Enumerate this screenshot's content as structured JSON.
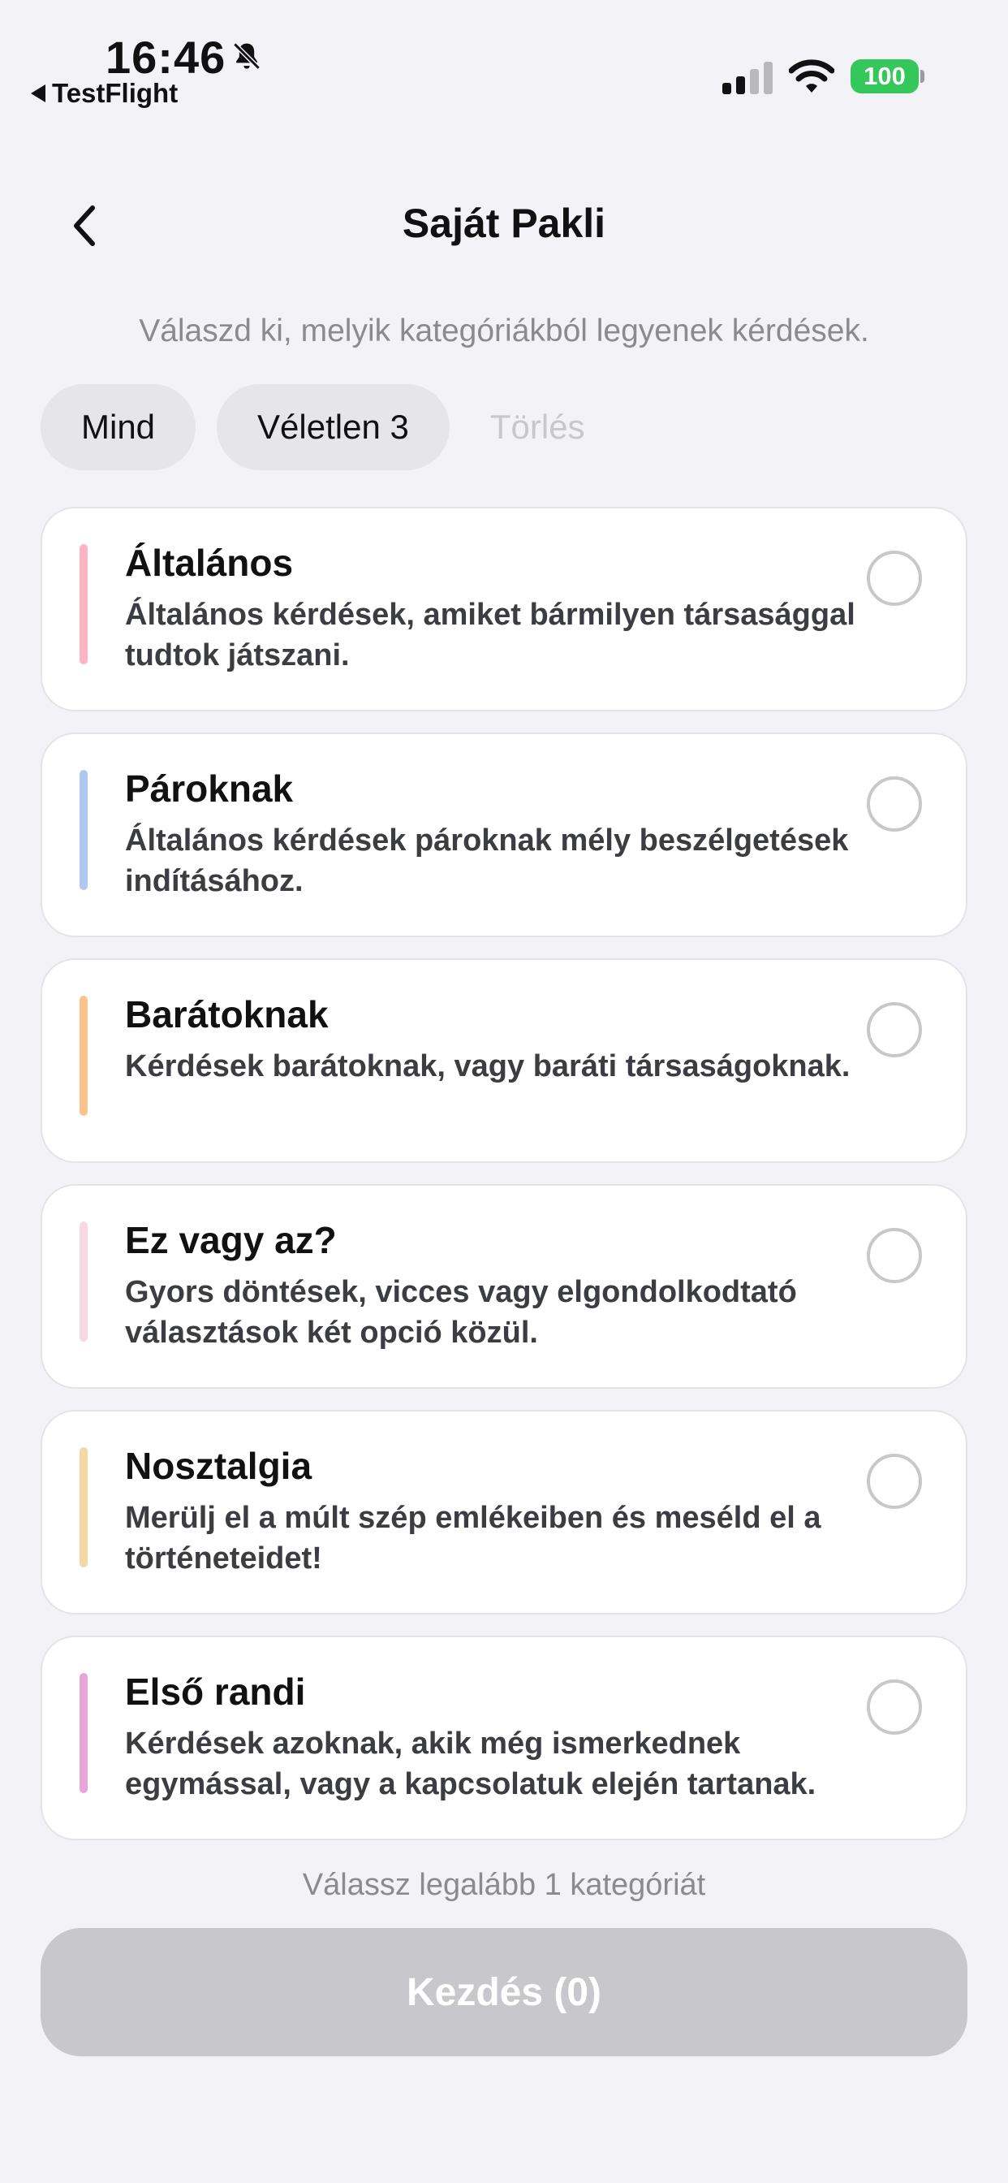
{
  "status_bar": {
    "time": "16:46",
    "back_app": "TestFlight",
    "battery": "100",
    "icons": [
      "bell-slash-icon",
      "cellular-signal-icon",
      "wifi-icon",
      "battery-icon"
    ]
  },
  "header": {
    "title": "Saját Pakli",
    "back_icon": "chevron-left-icon"
  },
  "subtitle": "Válaszd ki, melyik kategóriákból legyenek kérdések.",
  "chips": {
    "all": "Mind",
    "random": "Véletlen 3",
    "clear": "Törlés"
  },
  "categories": [
    {
      "title": "Általános",
      "description": "Általános kérdések, amiket bármilyen társasággal tudtok játszani.",
      "color": "#fbb5c4",
      "selected": false
    },
    {
      "title": "Pároknak",
      "description": "Általános kérdések pároknak mély beszélgetések indításához.",
      "color": "#aec8ef",
      "selected": false
    },
    {
      "title": "Barátoknak",
      "description": "Kérdések barátoknak, vagy baráti társaságoknak.",
      "color": "#f9c48f",
      "selected": false
    },
    {
      "title": "Ez vagy az?",
      "description": "Gyors döntések, vicces vagy elgondolkodtató választások két opció közül.",
      "color": "#f8d8e2",
      "selected": false
    },
    {
      "title": "Nosztalgia",
      "description": "Merülj el a múlt szép emlékeiben és meséld el a történeteidet!",
      "color": "#f4d9a6",
      "selected": false
    },
    {
      "title": "Első randi",
      "description": "Kérdések azoknak, akik még ismerkednek egymással, vagy a kapcsolatuk elején tartanak.",
      "color": "#e8a5da",
      "selected": false
    }
  ],
  "hint": "Válassz legalább 1 kategóriát",
  "start_button": "Kezdés (0)",
  "colors": {
    "background": "#f2f2f7",
    "disabled_button": "#c7c7cc",
    "battery_green": "#34c759"
  }
}
